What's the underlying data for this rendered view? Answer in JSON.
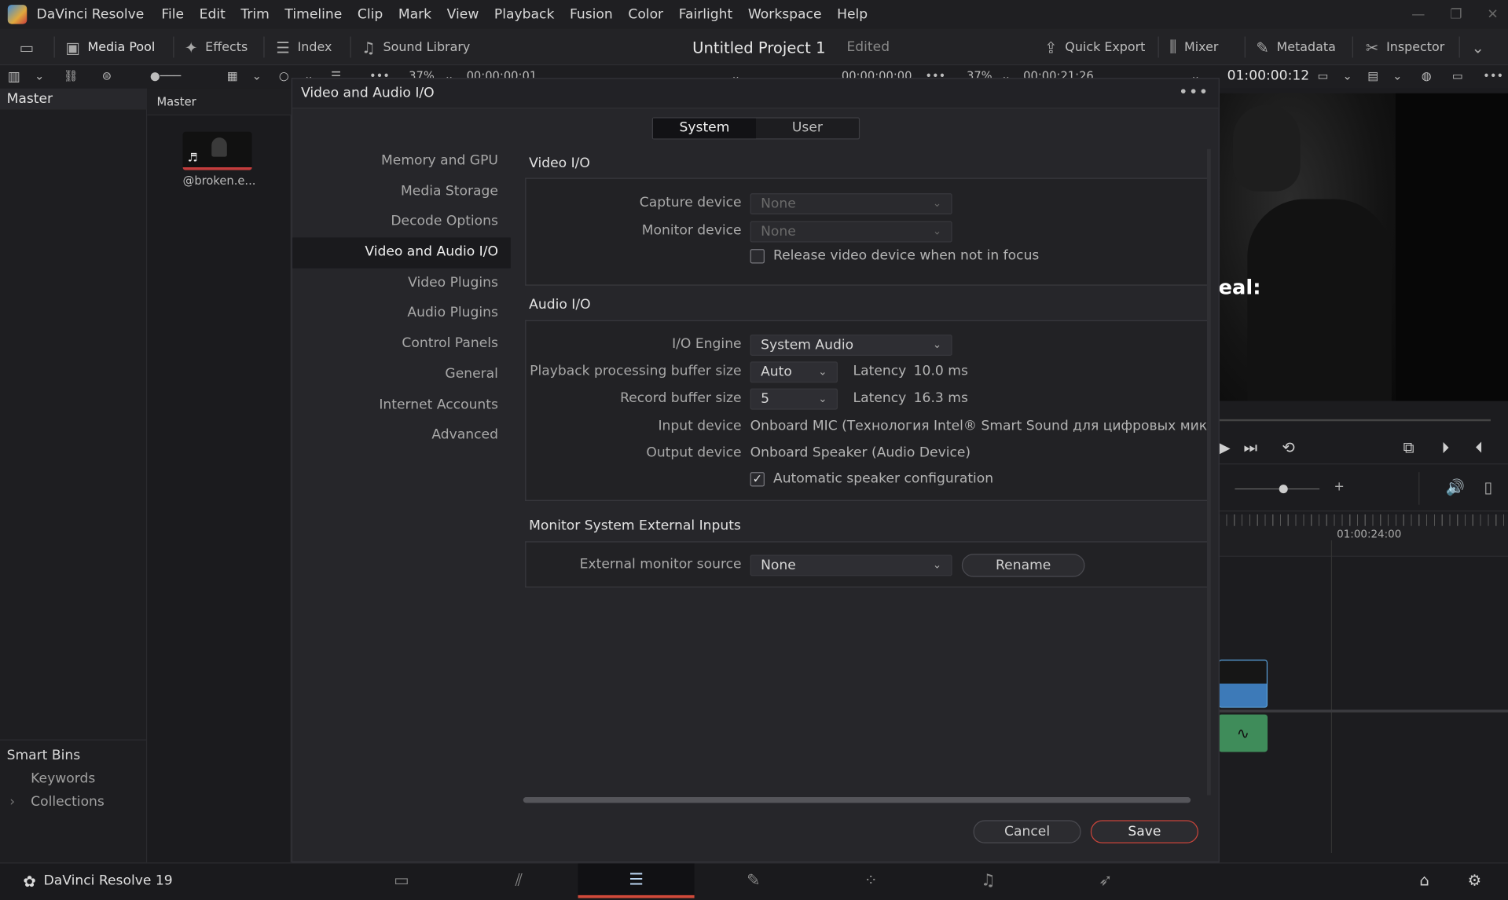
{
  "menubar": {
    "app_name": "DaVinci Resolve",
    "items": [
      "File",
      "Edit",
      "Trim",
      "Timeline",
      "Clip",
      "Mark",
      "View",
      "Playback",
      "Fusion",
      "Color",
      "Fairlight",
      "Workspace",
      "Help"
    ]
  },
  "toolbar": {
    "media_pool": "Media Pool",
    "effects": "Effects",
    "index": "Index",
    "sound_library": "Sound Library",
    "project_title": "Untitled Project 1",
    "project_status": "Edited",
    "quick_export": "Quick Export",
    "mixer": "Mixer",
    "metadata": "Metadata",
    "inspector": "Inspector"
  },
  "subbar": {
    "zoom_left": "37%",
    "timecode_left": "00:00:00:01",
    "timecode_mid": "00:00:00:00",
    "zoom_right": "37%",
    "timecode_right": "00:00:21:26",
    "timecode_record": "01:00:00:12"
  },
  "bins": {
    "master": "Master",
    "smart_bins": "Smart Bins",
    "keywords": "Keywords",
    "collections": "Collections"
  },
  "pool": {
    "header": "Master",
    "clip_name": "@broken.e..."
  },
  "viewer": {
    "subtitle_fragment": "eal:",
    "ruler_timecode": "01:00:24:00"
  },
  "pagebar": {
    "brand": "DaVinci Resolve 19"
  },
  "dialog": {
    "title": "Video and Audio I/O",
    "segments": [
      "System",
      "User"
    ],
    "nav": [
      "Memory and GPU",
      "Media Storage",
      "Decode Options",
      "Video and Audio I/O",
      "Video Plugins",
      "Audio Plugins",
      "Control Panels",
      "General",
      "Internet Accounts",
      "Advanced"
    ],
    "video_io": {
      "title": "Video I/O",
      "capture_label": "Capture device",
      "capture_value": "None",
      "monitor_label": "Monitor device",
      "monitor_value": "None",
      "release_label": "Release video device when not in focus",
      "release_checked": false
    },
    "audio_io": {
      "title": "Audio I/O",
      "engine_label": "I/O Engine",
      "engine_value": "System Audio",
      "playback_label": "Playback processing buffer size",
      "playback_value": "Auto",
      "latency_label": "Latency",
      "playback_latency": "10.0 ms",
      "record_label": "Record buffer size",
      "record_value": "5",
      "record_latency": "16.3 ms",
      "input_label": "Input device",
      "input_value": "Onboard MIC (Технология Intel® Smart Sound для цифровых микрофонов)",
      "output_label": "Output device",
      "output_value": "Onboard Speaker (Audio Device)",
      "auto_speaker_label": "Automatic speaker configuration",
      "auto_speaker_checked": true
    },
    "monitor_ext": {
      "title": "Monitor System External Inputs",
      "source_label": "External monitor source",
      "source_value": "None",
      "rename": "Rename"
    },
    "cancel": "Cancel",
    "save": "Save"
  },
  "colors": {
    "accent_red": "#d24a3a",
    "clip_blue": "#3d7ab8",
    "clip_green": "#3f8c5a"
  }
}
